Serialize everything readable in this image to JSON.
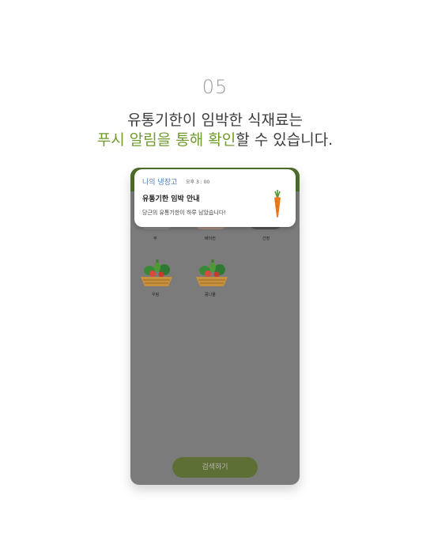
{
  "step_number": "05",
  "headline": {
    "line1": "유통기한이 임박한 식재료는",
    "line2_highlight": "푸시 알림을 통해 확인",
    "line2_rest": "할 수 있습니다."
  },
  "notification": {
    "app_name": "나의 냉장고",
    "time": "오후 3 : 00",
    "title": "유통기한 임박 안내",
    "body": "당근의 유통기한이 하루 남았습니다!",
    "icon": "carrot-icon"
  },
  "fridge_items": [
    {
      "label": "무",
      "icon": "radish-icon"
    },
    {
      "label": "베이컨",
      "icon": "bacon-icon"
    },
    {
      "label": "간장",
      "icon": "soy-sauce-icon"
    },
    {
      "label": "우렁",
      "icon": "vegetable-basket-icon"
    },
    {
      "label": "콩나물",
      "icon": "vegetable-basket-icon"
    }
  ],
  "search_button_label": "검색하기",
  "colors": {
    "highlight_green": "#6f9a2d",
    "top_bar_green": "#4f6e2a",
    "overlay_gray": "#7b7b7b",
    "button_olive": "#5d6f34",
    "app_name_blue": "#4d7ab5"
  }
}
